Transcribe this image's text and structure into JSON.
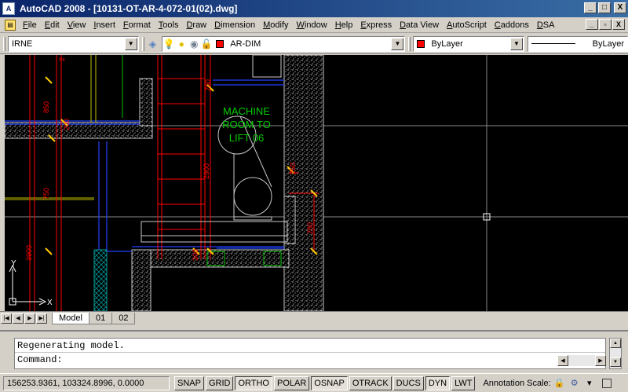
{
  "window": {
    "app_icon": "A",
    "title": "AutoCAD 2008 - [10131-OT-AR-4-072-01(02).dwg]",
    "minimize": "_",
    "restore": "□",
    "close": "X"
  },
  "menu": {
    "items": [
      "File",
      "Edit",
      "View",
      "Insert",
      "Format",
      "Tools",
      "Draw",
      "Dimension",
      "Modify",
      "Window",
      "Help",
      "Express",
      "Data View",
      "AutoScript",
      "Caddons",
      "DSA"
    ],
    "doc_minimize": "_",
    "doc_restore": "▫",
    "doc_close": "X"
  },
  "toolbar": {
    "layer_filter": "IRNE",
    "current_layer": "AR-DIM",
    "color": "ByLayer",
    "linetype": "ByLayer",
    "layer_color": "#ff0000",
    "color_swatch": "#ff0000"
  },
  "drawing": {
    "label_line1": "MACHINE",
    "label_line2": "ROOM TO",
    "label_line3": "LIFT 06",
    "dim_labels": [
      "2",
      "850",
      "750",
      "3900",
      "2900",
      "200",
      "300",
      "200",
      "280",
      "250"
    ],
    "ucs_y": "Y",
    "ucs_x": "X",
    "background": "#000000",
    "wall_color": "#c8c8c8",
    "dim_color": "#ff0000",
    "text_color": "#00cc00",
    "crosshair_color": "#ffffff"
  },
  "tabs": {
    "items": [
      "Model",
      "01",
      "02"
    ],
    "active": "Model"
  },
  "command": {
    "history": "Regenerating model.",
    "prompt": "Command:"
  },
  "status": {
    "coordinates": "156253.9361, 103324.8996, 0.0000",
    "buttons": [
      {
        "label": "SNAP",
        "on": false
      },
      {
        "label": "GRID",
        "on": false
      },
      {
        "label": "ORTHO",
        "on": true
      },
      {
        "label": "POLAR",
        "on": false
      },
      {
        "label": "OSNAP",
        "on": true
      },
      {
        "label": "OTRACK",
        "on": false
      },
      {
        "label": "DUCS",
        "on": false
      },
      {
        "label": "DYN",
        "on": true
      },
      {
        "label": "LWT",
        "on": false
      }
    ],
    "annotation_scale_label": "Annotation Scale:"
  }
}
